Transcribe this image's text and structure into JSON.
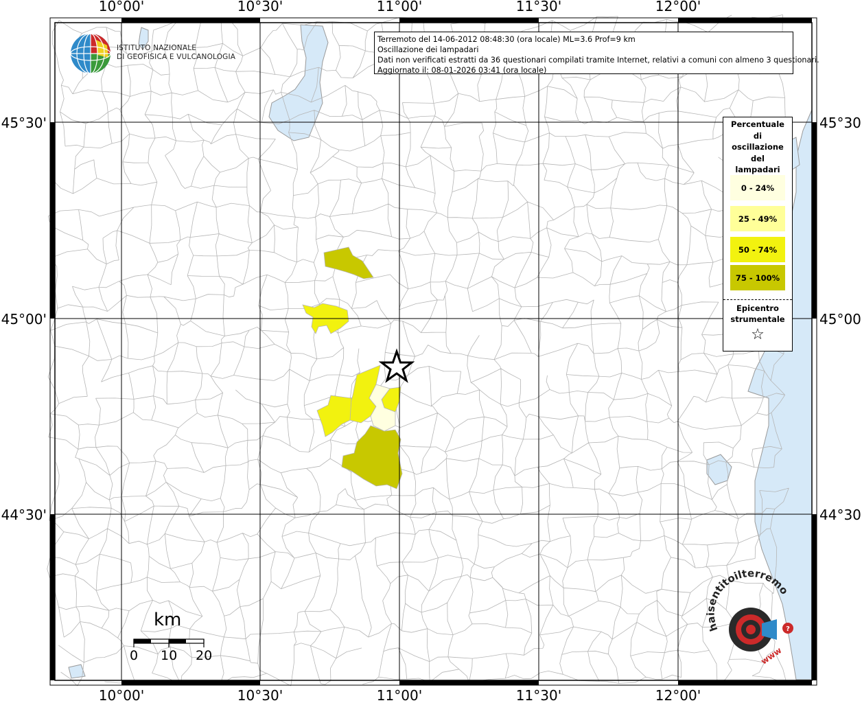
{
  "header": {
    "agency_line1": "ISTITUTO NAZIONALE",
    "agency_line2": "DI GEOFISICA E VULCANOLOGIA"
  },
  "info": {
    "line1": "Terremoto del 14-06-2012 08:48:30 (ora locale) ML=3.6 Prof=9 km",
    "line2": "Oscillazione dei lampadari",
    "line3": "Dati non verificati estratti da 36 questionari compilati tramite Internet, relativi a comuni con almeno 3 questionari.",
    "line4": "Aggiornato il: 08-01-2026 03:41 (ora locale)"
  },
  "axes": {
    "top": [
      "10°00'",
      "10°30'",
      "11°00'",
      "11°30'",
      "12°00'"
    ],
    "bottom": [
      "10°00'",
      "10°30'",
      "11°00'",
      "11°30'",
      "12°00'"
    ],
    "left": [
      "45°30'",
      "45°00'",
      "44°30'"
    ],
    "right": [
      "45°30'",
      "45°00'",
      "44°30'"
    ]
  },
  "legend": {
    "title_lines": [
      "Percentuale",
      "di",
      "oscillazione",
      "del",
      "lampadari"
    ],
    "items": [
      {
        "label": "0 - 24%",
        "color": "#ffffe0"
      },
      {
        "label": "25 - 49%",
        "color": "#ffff99"
      },
      {
        "label": "50 - 74%",
        "color": "#f2f20f"
      },
      {
        "label": "75 - 100%",
        "color": "#c8c800"
      }
    ],
    "epicenter_line1": "Epicentro",
    "epicenter_line2": "strumentale",
    "epicenter_symbol": "☆"
  },
  "scale": {
    "unit": "km",
    "ticks": [
      "0",
      "10",
      "20"
    ]
  },
  "watermark": {
    "text": "haisentitoilterremoto.it",
    "site": "www"
  },
  "colors": {
    "water": "#d6e9f8",
    "border": "#b0b0b0",
    "grid": "#000000"
  }
}
